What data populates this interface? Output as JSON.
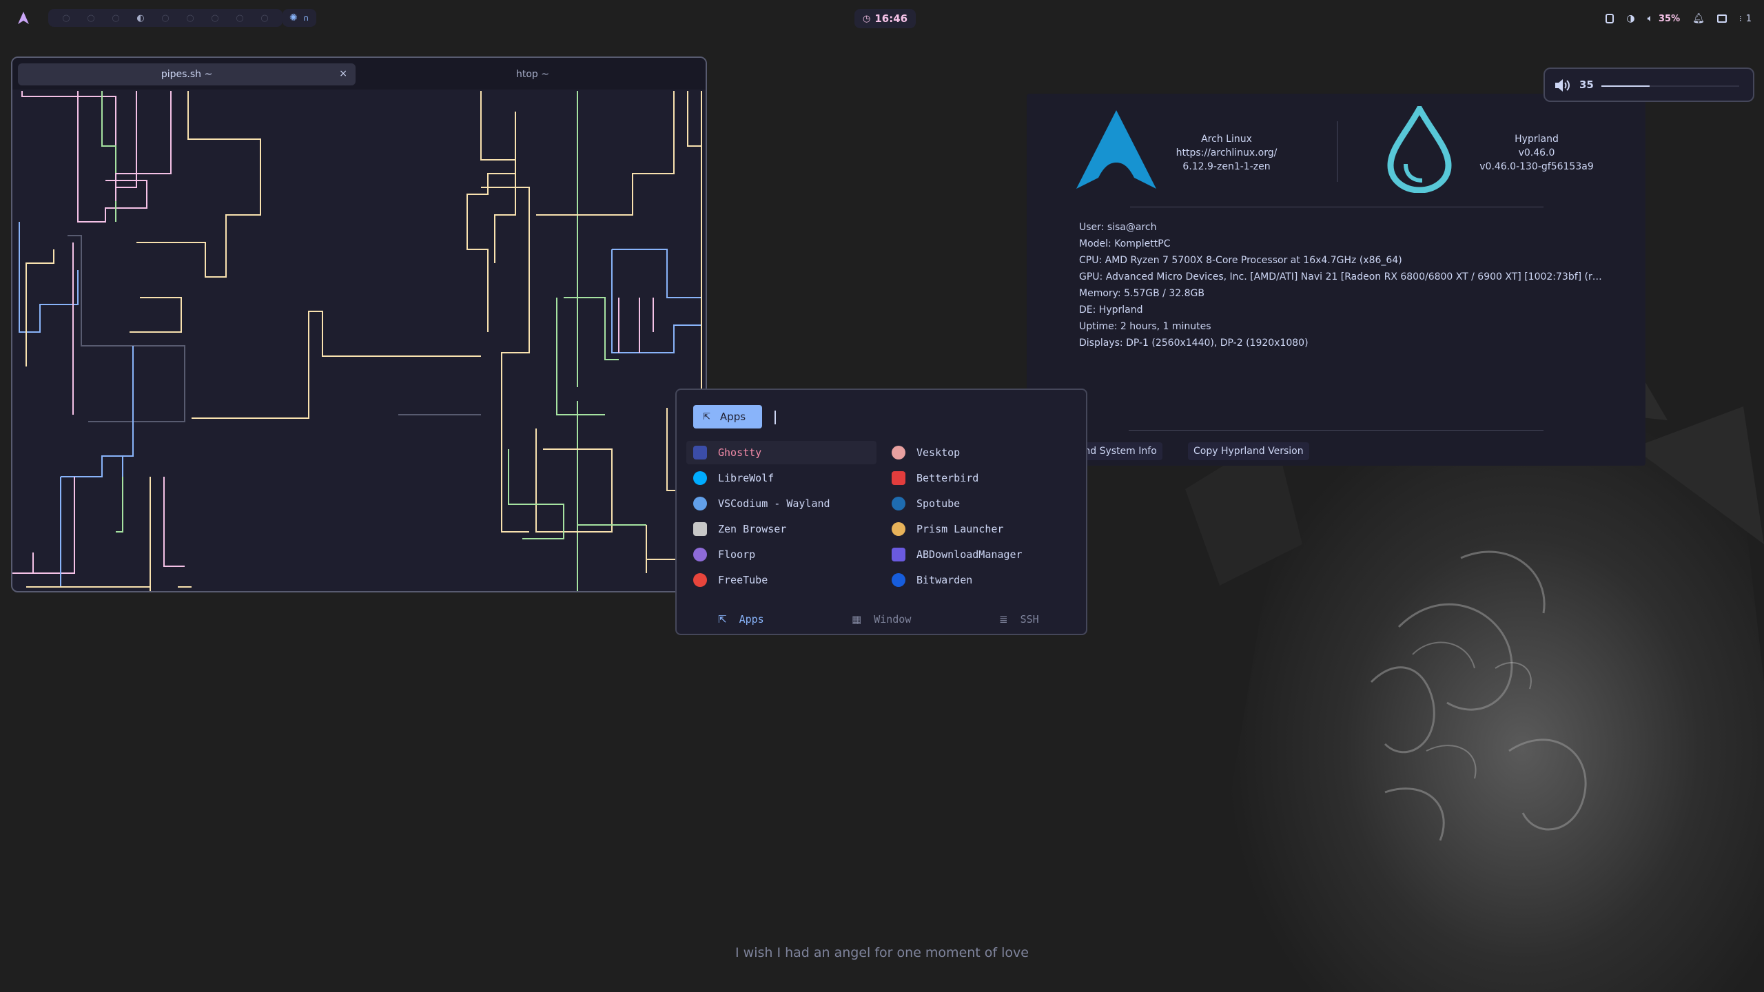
{
  "topbar": {
    "clock": "16:46",
    "volume_percent": "35%",
    "workspace_indicator": "1",
    "colors": {
      "accent": "#f5c2e7",
      "active": "#89b4fa"
    }
  },
  "terminal": {
    "tabs": [
      {
        "label": "pipes.sh ~",
        "active": true
      },
      {
        "label": "htop ~",
        "active": false
      }
    ],
    "close_glyph": "×"
  },
  "sysinfo": {
    "distro": {
      "name": "Arch Linux",
      "url": "https://archlinux.org/",
      "kernel": "6.12.9-zen1-1-zen"
    },
    "wm": {
      "name": "Hyprland",
      "version": "v0.46.0",
      "build": "v0.46.0-130-gf56153a9"
    },
    "lines": [
      "User: sisa@arch",
      "Model: KomplettPC",
      "CPU: AMD Ryzen 7 5700X 8-Core Processor at 16x4.7GHz (x86_64)",
      "GPU: Advanced Micro Devices, Inc. [AMD/ATI] Navi 21 [Radeon RX 6800/6800 XT / 6900 XT] [1002:73bf] (r…",
      "Memory: 5.57GB / 32.8GB",
      "DE: Hyprland",
      "Uptime: 2 hours, 1 minutes",
      "Displays: DP-1 (2560x1440), DP-2 (1920x1080)"
    ],
    "buttons": {
      "system_info": "yprland System Info",
      "copy_version": "Copy Hyprland Version"
    }
  },
  "volume_osd": {
    "value": "35",
    "level": 0.35
  },
  "launcher": {
    "mode_label": "Apps",
    "apps": [
      {
        "name": "Ghostty",
        "icon": "ghostty-icon",
        "color": "#3b4da8",
        "selected": true
      },
      {
        "name": "Vesktop",
        "icon": "vesktop-icon",
        "color": "#e8a0a0",
        "selected": false
      },
      {
        "name": "LibreWolf",
        "icon": "librewolf-icon",
        "color": "#00acff",
        "selected": false
      },
      {
        "name": "Betterbird",
        "icon": "betterbird-icon",
        "color": "#e23d3d",
        "selected": false
      },
      {
        "name": "VSCodium - Wayland",
        "icon": "vscodium-icon",
        "color": "#62a0ea",
        "selected": false
      },
      {
        "name": "Spotube",
        "icon": "spotube-icon",
        "color": "#1e6cb0",
        "selected": false
      },
      {
        "name": "Zen Browser",
        "icon": "zen-browser-icon",
        "color": "#c8c8c8",
        "selected": false
      },
      {
        "name": "Prism Launcher",
        "icon": "prism-launcher-icon",
        "color": "#e8b35a",
        "selected": false
      },
      {
        "name": "Floorp",
        "icon": "floorp-icon",
        "color": "#8e6bd8",
        "selected": false
      },
      {
        "name": "ABDownloadManager",
        "icon": "abdownloadmanager-icon",
        "color": "#6a5ae0",
        "selected": false
      },
      {
        "name": "FreeTube",
        "icon": "freetube-icon",
        "color": "#e8453c",
        "selected": false
      },
      {
        "name": "Bitwarden",
        "icon": "bitwarden-icon",
        "color": "#175ddc",
        "selected": false
      }
    ],
    "modes": [
      {
        "label": "Apps",
        "icon": "external-link-icon",
        "active": true
      },
      {
        "label": "Window",
        "icon": "grid-icon",
        "active": false
      },
      {
        "label": "SSH",
        "icon": "list-icon",
        "active": false
      }
    ]
  },
  "lyric": "I wish I had an angel for one moment of love"
}
